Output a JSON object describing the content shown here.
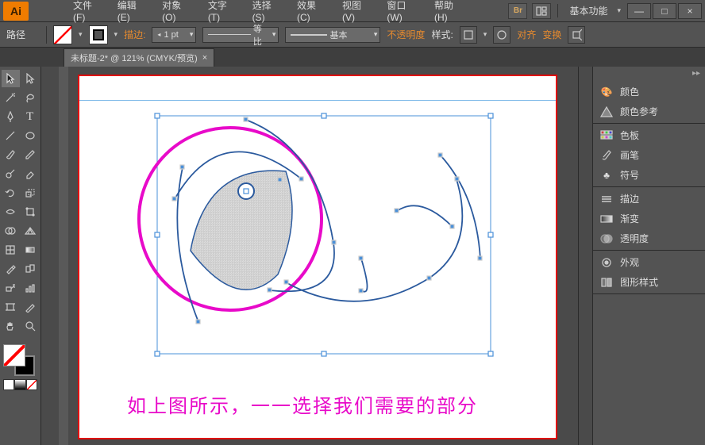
{
  "app": {
    "logo_text": "Ai",
    "layout_preset": "基本功能"
  },
  "menu": {
    "items": [
      "文件(F)",
      "编辑(E)",
      "对象(O)",
      "文字(T)",
      "选择(S)",
      "效果(C)",
      "视图(V)",
      "窗口(W)",
      "帮助(H)"
    ]
  },
  "options": {
    "context_label": "路径",
    "stroke_label": "描边:",
    "stroke_pt": "1 pt",
    "dash_label": "等比",
    "profile_label": "基本",
    "opacity_label": "不透明度",
    "style_label": "样式:",
    "align_label": "对齐",
    "transform_label": "变换"
  },
  "tab": {
    "title": "未标题-2* @ 121% (CMYK/预览)"
  },
  "panels": {
    "color": "颜色",
    "color_guide": "颜色参考",
    "swatches": "色板",
    "brushes": "画笔",
    "symbols": "符号",
    "stroke": "描边",
    "gradient": "渐变",
    "transparency": "透明度",
    "appearance": "外观",
    "graphic_styles": "图形样式"
  },
  "canvas": {
    "caption": "如上图所示，一一选择我们需要的部分"
  },
  "win": {
    "min": "—",
    "max": "□",
    "close": "×"
  }
}
